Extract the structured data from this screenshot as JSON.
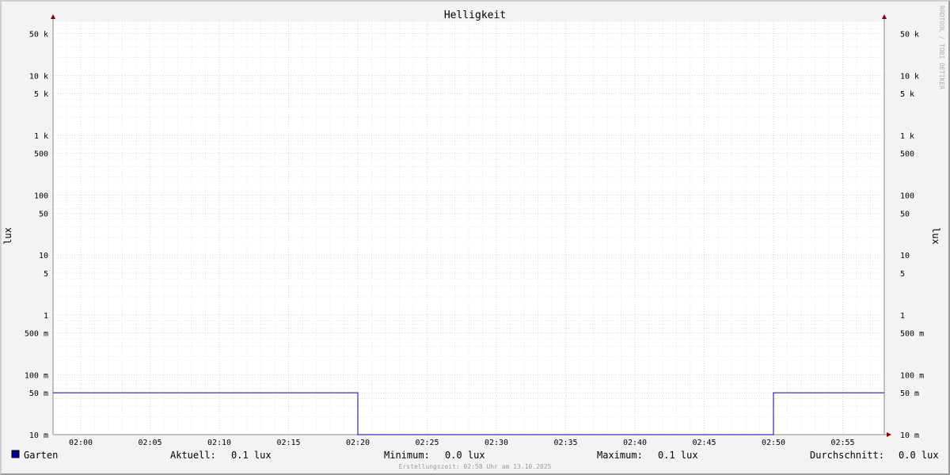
{
  "chart_data": {
    "type": "line",
    "title": "Helligkeit",
    "ylabel": "lux",
    "y_scale": "log",
    "ylim": [
      0.01,
      80000
    ],
    "xlim_minutes": [
      "01:58",
      "02:58"
    ],
    "y_ticks": [
      {
        "value": 50000,
        "label": "50 k"
      },
      {
        "value": 10000,
        "label": "10 k"
      },
      {
        "value": 5000,
        "label": "5 k"
      },
      {
        "value": 1000,
        "label": "1 k"
      },
      {
        "value": 500,
        "label": "500"
      },
      {
        "value": 100,
        "label": "100"
      },
      {
        "value": 50,
        "label": "50"
      },
      {
        "value": 10,
        "label": "10"
      },
      {
        "value": 5,
        "label": "5"
      },
      {
        "value": 1,
        "label": "1"
      },
      {
        "value": 0.5,
        "label": "500 m"
      },
      {
        "value": 0.1,
        "label": "100 m"
      },
      {
        "value": 0.05,
        "label": "50 m"
      },
      {
        "value": 0.01,
        "label": "10 m"
      }
    ],
    "x_ticks": [
      "02:00",
      "02:05",
      "02:10",
      "02:15",
      "02:20",
      "02:25",
      "02:30",
      "02:35",
      "02:40",
      "02:45",
      "02:50",
      "02:55"
    ],
    "series": [
      {
        "name": "Garten",
        "color": "#000099",
        "points": [
          {
            "x": "01:58",
            "y": 0.05
          },
          {
            "x": "02:20",
            "y": 0.05
          },
          {
            "x": "02:20",
            "y": 0.01
          },
          {
            "x": "02:50",
            "y": 0.01
          },
          {
            "x": "02:50",
            "y": 0.05
          },
          {
            "x": "02:58",
            "y": 0.05
          }
        ]
      }
    ],
    "grid": true
  },
  "legend": {
    "series_name": "Garten",
    "series_color": "#000099",
    "stats": [
      {
        "label": "Aktuell:",
        "value": "0.1 lux"
      },
      {
        "label": "Minimum:",
        "value": "0.0 lux"
      },
      {
        "label": "Maximum:",
        "value": "0.1 lux"
      },
      {
        "label": "Durchschnitt:",
        "value": "0.0 lux"
      }
    ]
  },
  "footer": "Erstellungszeit: 02:58 Uhr am 13.10.2025",
  "watermark": "RRDTOOL / TOBI OETIKER",
  "colors": {
    "grid_minor": "#d8d8d8",
    "grid_major": "#e7a8b0",
    "axis": "#888888",
    "arrow": "#8b0000"
  }
}
